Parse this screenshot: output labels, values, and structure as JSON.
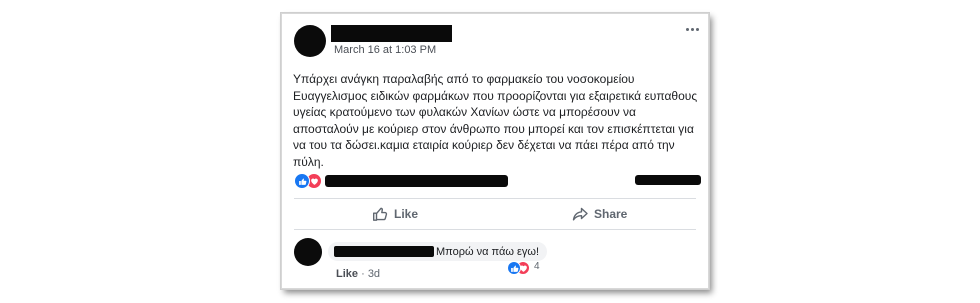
{
  "post": {
    "timestamp": "March 16 at 1:03 PM",
    "body": "Υπάρχει ανάγκη παραλαβής από το φαρμακείο του νοσοκομείου Ευαγγελισμος ειδικών φαρμάκων που προορίζονται για εξαιρετικά ευπαθους υγείας κρατούμενο των φυλακών Χανίων ώστε να μπορέσουν να αποσταλούν με κούριερ στον άνθρωπο που μπορεί και τον επισκέπτεται για να του τα δώσει.καμια εταιρία κούριερ δεν δέχεται να πάει πέρα από την πύλη.",
    "reactions": [
      "like",
      "love"
    ]
  },
  "actions": {
    "like_label": "Like",
    "share_label": "Share"
  },
  "comment": {
    "text": "Μπορώ να πάω εγω!",
    "reaction_count": "4",
    "like_label": "Like",
    "separator": "·",
    "age": "3d"
  },
  "colors": {
    "like_blue": "#1877f2",
    "love_red": "#f33e58",
    "redaction": "#0a0a0a"
  }
}
